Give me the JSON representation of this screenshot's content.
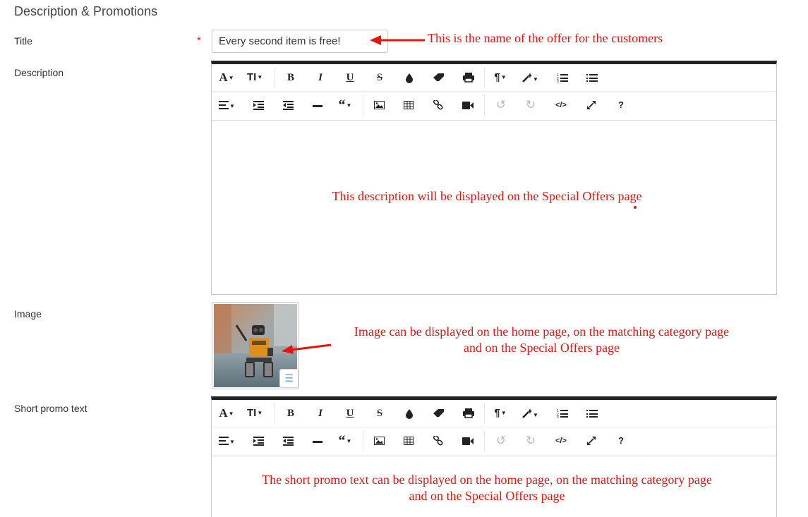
{
  "section": {
    "title": "Description & Promotions"
  },
  "fields": {
    "title_label": "Title",
    "required_mark": "*",
    "title_value": "Every second item is free!",
    "description_label": "Description",
    "image_label": "Image",
    "short_promo_label": "Short promo text"
  },
  "toolbar": {
    "font": "A",
    "font_size": "TƖ",
    "bold": "B",
    "italic": "I",
    "underline": "U",
    "strikethrough": "S",
    "paragraph": "¶",
    "blockquote": "“",
    "undo": "↺",
    "redo": "↻",
    "code_view": "</>",
    "help": "?"
  },
  "annotations": {
    "title_note": "This is the name of the offer for the customers",
    "description_note": "This description will be displayed on the Special Offers page",
    "image_note_line1": "Image can be displayed on the home page, on the matching category page",
    "image_note_line2": "and on the Special Offers page",
    "promo_note_line1": "The short promo text can be displayed on the home page, on the matching category page",
    "promo_note_line2": "and on the Special Offers page"
  },
  "colors": {
    "annotation": "#e8140c",
    "editor_top_border": "#222222",
    "required": "#d9261c",
    "image_menu_icon": "#5b9bd5"
  },
  "icons": [
    "font-icon",
    "font-size-icon",
    "bold-icon",
    "italic-icon",
    "underline-icon",
    "strikethrough-icon",
    "color-drop-icon",
    "eraser-icon",
    "print-icon",
    "paragraph-icon",
    "magic-wand-icon",
    "ordered-list-icon",
    "unordered-list-icon",
    "align-icon",
    "indent-icon",
    "outdent-icon",
    "horizontal-rule-icon",
    "blockquote-icon",
    "image-icon",
    "table-icon",
    "link-icon",
    "video-icon",
    "undo-icon",
    "redo-icon",
    "code-view-icon",
    "fullscreen-icon",
    "help-icon",
    "hamburger-menu-icon",
    "red-arrow-icon"
  ]
}
